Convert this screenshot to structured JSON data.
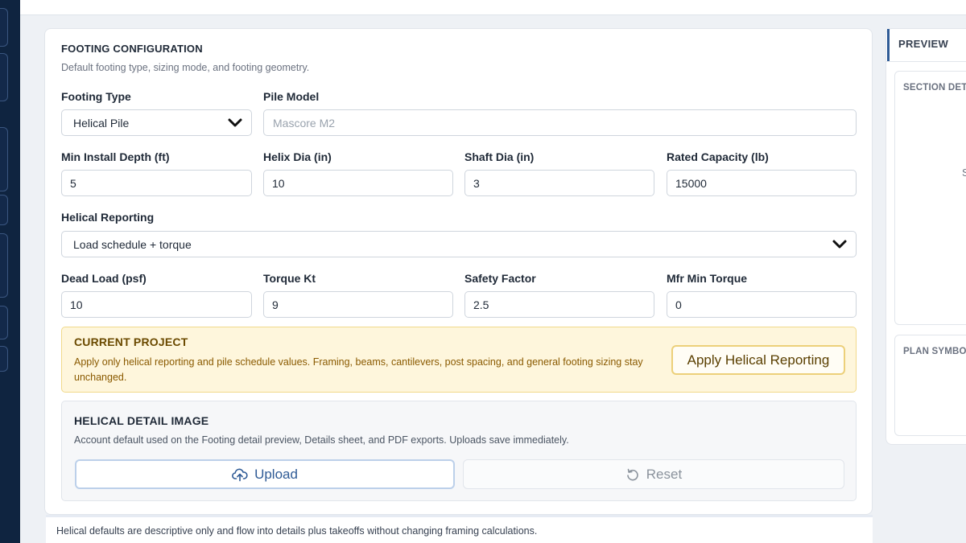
{
  "section": {
    "title": "FOOTING CONFIGURATION",
    "subtitle": "Default footing type, sizing mode, and footing geometry."
  },
  "fields": {
    "footing_type": {
      "label": "Footing Type",
      "value": "Helical Pile"
    },
    "pile_model": {
      "label": "Pile Model",
      "placeholder": "Mascore M2"
    },
    "min_install_depth": {
      "label": "Min Install Depth (ft)",
      "value": "5"
    },
    "helix_dia": {
      "label": "Helix Dia (in)",
      "value": "10"
    },
    "shaft_dia": {
      "label": "Shaft Dia (in)",
      "value": "3"
    },
    "rated_capacity": {
      "label": "Rated Capacity (lb)",
      "value": "15000"
    },
    "helical_reporting": {
      "label": "Helical Reporting",
      "value": "Load schedule + torque"
    },
    "dead_load": {
      "label": "Dead Load (psf)",
      "value": "10"
    },
    "torque_kt": {
      "label": "Torque Kt",
      "value": "9"
    },
    "safety_factor": {
      "label": "Safety Factor",
      "value": "2.5"
    },
    "mfr_min_torque": {
      "label": "Mfr Min Torque",
      "value": "0"
    }
  },
  "current_project": {
    "title": "CURRENT PROJECT",
    "text": "Apply only helical reporting and pile schedule values. Framing, beams, cantilevers, post spacing, and general footing sizing stay unchanged.",
    "button": "Apply Helical Reporting"
  },
  "detail_image": {
    "title": "HELICAL DETAIL IMAGE",
    "subtitle": "Account default used on the Footing detail preview, Details sheet, and PDF exports. Uploads save immediately.",
    "upload_label": "Upload",
    "reset_label": "Reset"
  },
  "footer_note": "Helical defaults are descriptive only and flow into details plus takeoffs without changing framing calculations.",
  "preview": {
    "tab": "PREVIEW",
    "section_detail": "SECTION DET",
    "section_glyph": "S",
    "plan_symbol": "PLAN SYMBO"
  },
  "icons": {
    "dropdown": "chevron-down-icon",
    "upload": "cloud-upload-icon",
    "reset": "reset-icon"
  },
  "colors": {
    "rail": "#0f2440",
    "accent": "#2f5b96",
    "alert_bg": "#fef6dc",
    "alert_border": "#f1d98a",
    "alert_text": "#8a5a00"
  }
}
